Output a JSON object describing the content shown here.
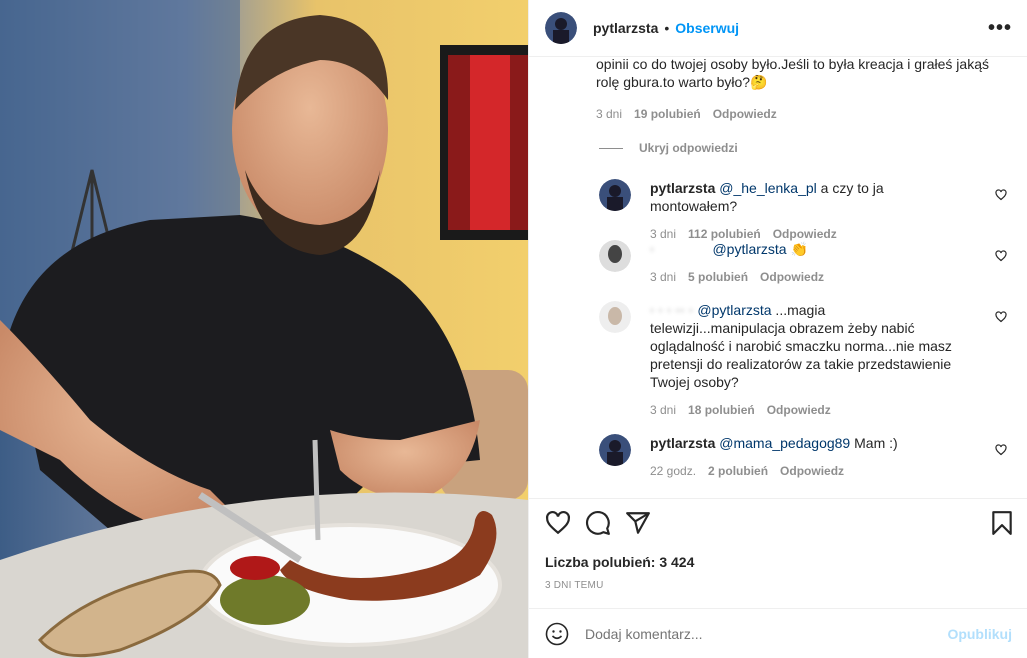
{
  "post": {
    "username": "pytlarzsta",
    "separator": "•",
    "follow_label": "Obserwuj",
    "more_icon": "more-options-icon"
  },
  "top_comment": {
    "text": "opinii co do twojej osoby było.Jeśli to była kreacja i grałeś jakąś rolę gbura.to warto było?🤔",
    "time": "3 dni",
    "likes": "19 polubień",
    "reply_label": "Odpowiedz"
  },
  "hide_replies_label": "Ukryj odpowiedzi",
  "replies": [
    {
      "user": "pytlarzsta",
      "mention": "@_he_lenka_pl",
      "text": " a czy to ja montowałem?",
      "time": "3 dni",
      "likes": "112 polubień",
      "reply_label": "Odpowiedz"
    },
    {
      "user": "·",
      "mention": "@pytlarzsta",
      "text": " 👏",
      "time": "3 dni",
      "likes": "5 polubień",
      "reply_label": "Odpowiedz"
    },
    {
      "user": "·  · ·  ·· ·",
      "mention": "@pytlarzsta",
      "text": " ...magia telewizji...manipulacja obrazem żeby nabić oglądalność i narobić smaczku norma...nie masz pretensji do realizatorów za takie przedstawienie Twojej osoby?",
      "time": "3 dni",
      "likes": "18 polubień",
      "reply_label": "Odpowiedz"
    },
    {
      "user": "pytlarzsta",
      "mention": "@mama_pedagog89",
      "text": " Mam :)",
      "time": "22 godz.",
      "likes": "2 polubień",
      "reply_label": "Odpowiedz"
    }
  ],
  "actions": {
    "like_icon": "heart-icon",
    "comment_icon": "comment-icon",
    "share_icon": "share-icon",
    "save_icon": "bookmark-icon"
  },
  "likes_count": "Liczba polubień: 3 424",
  "date": "3 DNI TEMU",
  "composer": {
    "emoji_icon": "emoji-icon",
    "placeholder": "Dodaj komentarz...",
    "publish_label": "Opublikuj"
  },
  "colors": {
    "accent": "#0095f6",
    "text": "#262626",
    "muted": "#8e8e8e",
    "publish_disabled": "#b2dffc"
  }
}
